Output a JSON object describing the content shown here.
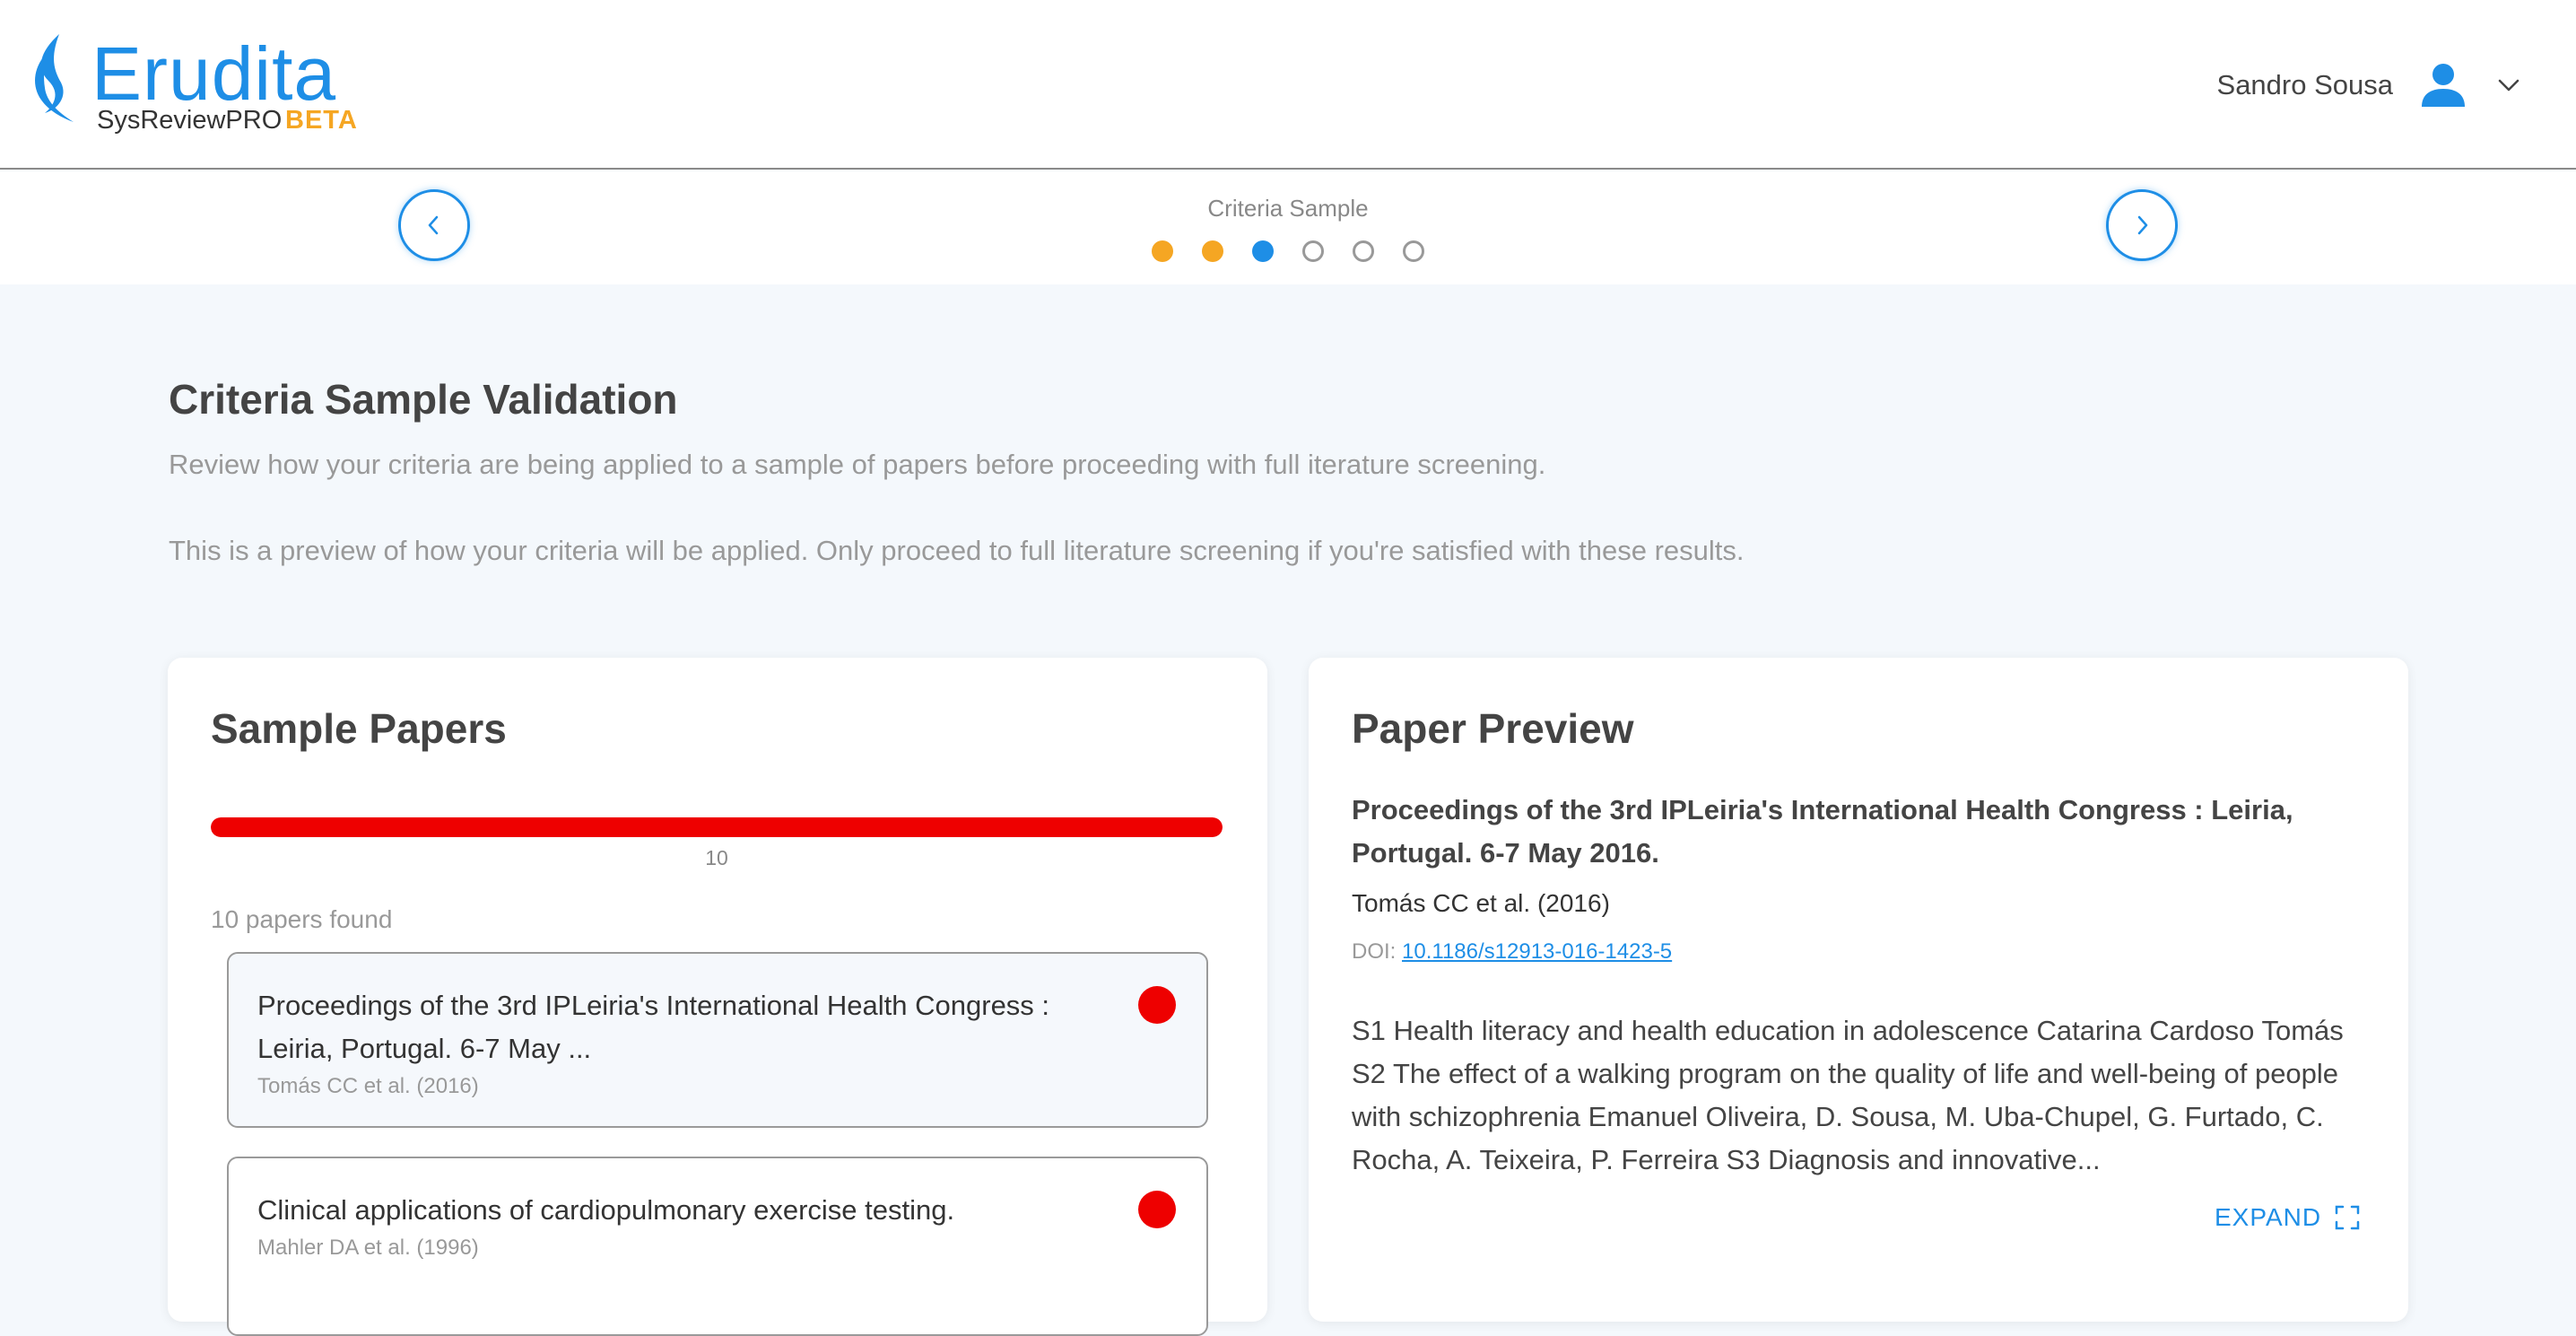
{
  "brand": {
    "name": "Erudita",
    "product": "SysReviewPRO",
    "badge": "BETA",
    "brand_color": "#1e8ee6",
    "badge_color": "#f5a623"
  },
  "user": {
    "name": "Sandro Sousa",
    "icon": "user-icon",
    "menu_icon": "chevron-down-icon"
  },
  "stepper": {
    "title": "Criteria Sample",
    "prev_icon": "chevron-left-icon",
    "next_icon": "chevron-right-icon",
    "steps": [
      "done",
      "done",
      "current",
      "todo",
      "todo",
      "todo"
    ]
  },
  "page": {
    "title": "Criteria Sample Validation",
    "description": "Review how your criteria are being applied to a sample of papers before proceeding with full iterature screening.",
    "note": "This is a preview of how your criteria will be applied. Only proceed to full literature screening if you're satisfied with these results."
  },
  "sample_papers": {
    "title": "Sample Papers",
    "progress_label": "10",
    "progress_fraction": 1.0,
    "progress_color": "#ee0000",
    "found_text": "10 papers found",
    "papers": [
      {
        "title": "Proceedings of the 3rd IPLeiria's International Health Congress : Leiria, Portugal. 6-7 May ...",
        "meta": "Tomás CC et al. (2016)",
        "status_color": "#ee0000"
      },
      {
        "title": "Clinical applications of cardiopulmonary exercise testing.",
        "meta": "Mahler DA et al. (1996)",
        "status_color": "#ee0000"
      }
    ]
  },
  "preview": {
    "title": "Paper Preview",
    "paper_title": "Proceedings of the 3rd IPLeiria's International Health Congress : Leiria, Portugal. 6-7 May 2016.",
    "authors": "Tomás CC et al. (2016)",
    "doi_label": "DOI:",
    "doi": "10.1186/s12913-016-1423-5",
    "abstract": "S1 Health literacy and health education in adolescence Catarina Cardoso Tomás S2 The effect of a walking program on the quality of life and well-being of people with schizophrenia Emanuel Oliveira, D. Sousa, M. Uba-Chupel, G. Furtado, C. Rocha, A. Teixeira, P. Ferreira S3 Diagnosis and innovative...",
    "expand_label": "EXPAND",
    "expand_icon": "expand-icon"
  }
}
